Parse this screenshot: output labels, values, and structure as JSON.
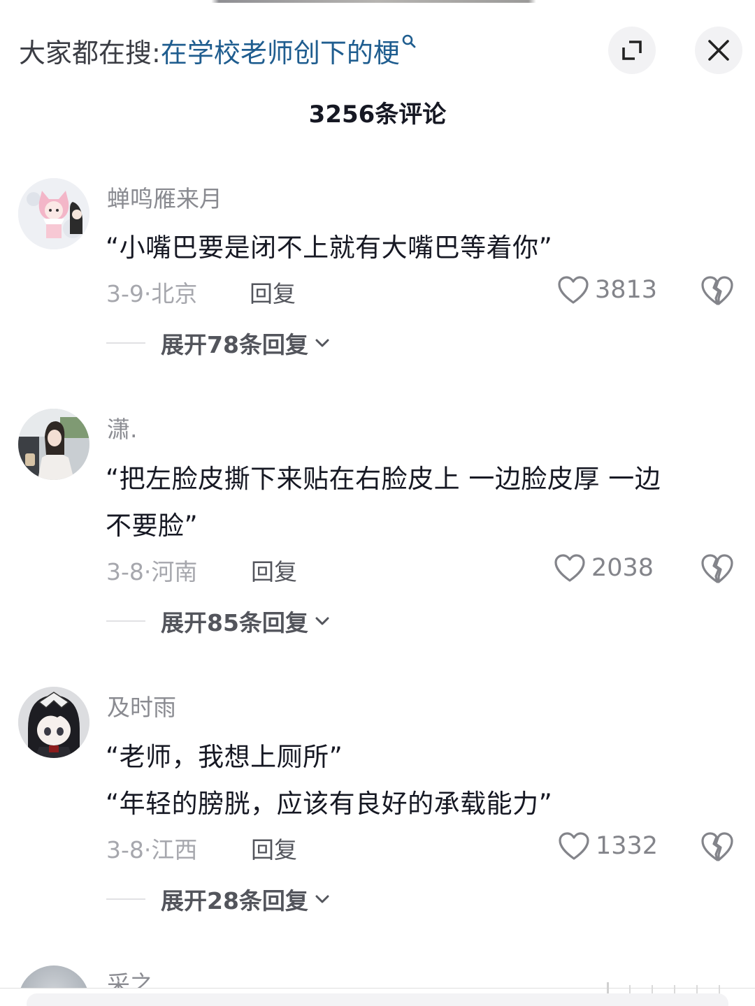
{
  "header": {
    "search_prefix": "大家都在搜:",
    "search_term": "在学校老师创下的梗",
    "search_icon": "search-icon",
    "expand_icon": "expand-icon",
    "close_icon": "close-icon"
  },
  "comment_count_label": "3256条评论",
  "comments": [
    {
      "username": "蝉鸣雁来月",
      "lines": [
        "“小嘴巴要是闭不上就有大嘴巴等着你”"
      ],
      "date": "3-9·北京",
      "reply_label": "回复",
      "likes": "3813",
      "expand_label": "展开78条回复"
    },
    {
      "username": "潇.",
      "lines": [
        "“把左脸皮撕下来贴在右脸皮上 一边脸皮厚 一边",
        "不要脸”"
      ],
      "date": "3-8·河南",
      "reply_label": "回复",
      "likes": "2038",
      "expand_label": "展开85条回复"
    },
    {
      "username": "及时雨",
      "lines": [
        "“老师，我想上厕所”",
        "“年轻的膀胱，应该有良好的承载能力”"
      ],
      "date": "3-8·江西",
      "reply_label": "回复",
      "likes": "1332",
      "expand_label": "展开28条回复"
    }
  ],
  "partial_comment": {
    "username": "采之"
  },
  "colors": {
    "accent_link": "#1f5d8f",
    "text_primary": "#161823",
    "text_secondary": "#8a8b91"
  }
}
